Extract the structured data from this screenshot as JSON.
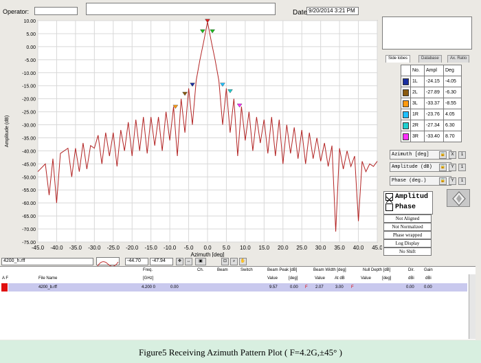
{
  "header": {
    "operator_label": "Operator:",
    "operator_value": "",
    "comment_value": "",
    "date_label": "Date",
    "date_value": "9/20/2014 3:21 PM"
  },
  "chart_data": {
    "type": "line",
    "title": "",
    "xlabel": "Azimuth  [deg]",
    "ylabel": "Amplitude  (dB)",
    "xlim": [
      -45,
      45
    ],
    "ylim": [
      -75,
      10
    ],
    "xticks": [
      "-45.0",
      "-40.0",
      "-35.0",
      "-30.0",
      "-25.0",
      "-20.0",
      "-15.0",
      "-10.0",
      "-5.0",
      "0.0",
      "5.0",
      "10.0",
      "15.0",
      "20.0",
      "25.0",
      "30.0",
      "35.0",
      "40.0",
      "45.0"
    ],
    "yticks": [
      "10.00",
      "5.00",
      "0.00",
      "-5.00",
      "-10.00",
      "-15.00",
      "-20.00",
      "-25.00",
      "-30.00",
      "-35.00",
      "-40.00",
      "-45.00",
      "-50.00",
      "-55.00",
      "-60.00",
      "-65.00",
      "-70.00",
      "-75.00"
    ],
    "grid": true,
    "series": [
      {
        "color": "#b22222",
        "points": [
          [
            -45,
            -48
          ],
          [
            -43,
            -45
          ],
          [
            -42,
            -57
          ],
          [
            -41,
            -43
          ],
          [
            -40,
            -60
          ],
          [
            -39,
            -41
          ],
          [
            -37,
            -39
          ],
          [
            -36,
            -50
          ],
          [
            -35,
            -39
          ],
          [
            -34,
            -48
          ],
          [
            -33,
            -37
          ],
          [
            -32,
            -47
          ],
          [
            -31,
            -38
          ],
          [
            -30,
            -39
          ],
          [
            -29,
            -34
          ],
          [
            -28,
            -45
          ],
          [
            -27,
            -33
          ],
          [
            -26,
            -42
          ],
          [
            -25,
            -33
          ],
          [
            -24,
            -46
          ],
          [
            -23,
            -32
          ],
          [
            -22,
            -40
          ],
          [
            -21,
            -29
          ],
          [
            -20,
            -42
          ],
          [
            -19,
            -28
          ],
          [
            -18,
            -40
          ],
          [
            -17,
            -27
          ],
          [
            -16,
            -41
          ],
          [
            -15,
            -27
          ],
          [
            -14,
            -38
          ],
          [
            -13,
            -27
          ],
          [
            -12,
            -40
          ],
          [
            -11,
            -25
          ],
          [
            -10,
            -36
          ],
          [
            -9,
            -23
          ],
          [
            -8,
            -42
          ],
          [
            -7,
            -20
          ],
          [
            -6,
            -33
          ],
          [
            -5,
            -16
          ],
          [
            -4,
            -30
          ],
          [
            -3,
            -13
          ],
          [
            -2,
            -5
          ],
          [
            -1,
            2
          ],
          [
            0,
            9.5
          ],
          [
            1,
            2
          ],
          [
            2,
            -5
          ],
          [
            3,
            -13
          ],
          [
            4,
            -30
          ],
          [
            5,
            -16
          ],
          [
            6,
            -33
          ],
          [
            7,
            -20
          ],
          [
            8,
            -42
          ],
          [
            9,
            -23
          ],
          [
            10,
            -36
          ],
          [
            11,
            -25
          ],
          [
            12,
            -40
          ],
          [
            13,
            -27
          ],
          [
            14,
            -37
          ],
          [
            15,
            -28
          ],
          [
            16,
            -41
          ],
          [
            17,
            -27
          ],
          [
            18,
            -42
          ],
          [
            19,
            -28
          ],
          [
            20,
            -45
          ],
          [
            21,
            -30
          ],
          [
            22,
            -41
          ],
          [
            23,
            -31
          ],
          [
            24,
            -43
          ],
          [
            25,
            -32
          ],
          [
            26,
            -45
          ],
          [
            27,
            -33
          ],
          [
            28,
            -43
          ],
          [
            29,
            -35
          ],
          [
            30,
            -44
          ],
          [
            31,
            -37
          ],
          [
            32,
            -46
          ],
          [
            33,
            -38
          ],
          [
            34,
            -71
          ],
          [
            35,
            -39
          ],
          [
            36,
            -47
          ],
          [
            37,
            -40
          ],
          [
            38,
            -46
          ],
          [
            39,
            -42
          ],
          [
            40,
            -67
          ],
          [
            41,
            -44
          ],
          [
            42,
            -48
          ],
          [
            43,
            -45
          ],
          [
            44,
            -46
          ],
          [
            45,
            -44
          ]
        ]
      }
    ],
    "markers": [
      {
        "x": 0,
        "y": 9.5,
        "color": "#e02020"
      },
      {
        "x": -1.3,
        "y": 5.5,
        "color": "#20c020"
      },
      {
        "x": 1.3,
        "y": 5.5,
        "color": "#20c020"
      },
      {
        "x": -4,
        "y": -15,
        "color": "#1a2fa0"
      },
      {
        "x": -6,
        "y": -18.5,
        "color": "#8a5a10"
      },
      {
        "x": -8.5,
        "y": -23.5,
        "color": "#ff9a10"
      },
      {
        "x": 4,
        "y": -15,
        "color": "#20c0ff"
      },
      {
        "x": 6,
        "y": -17.5,
        "color": "#20d0d0"
      },
      {
        "x": 8.5,
        "y": -23,
        "color": "#ff30ff"
      }
    ]
  },
  "side": {
    "tabs": [
      "Side lobes",
      "Database",
      "Ax. Ratio"
    ],
    "table_headers": [
      "No.",
      "Ampl",
      "Deg"
    ],
    "rows": [
      {
        "color": "#1a2fa0",
        "no": "1L",
        "ampl": "-24.15",
        "deg": "-4.05"
      },
      {
        "color": "#8a5a10",
        "no": "2L",
        "ampl": "-27.89",
        "deg": "-6.30"
      },
      {
        "color": "#ff9a10",
        "no": "3L",
        "ampl": "-33.37",
        "deg": "-8.55"
      },
      {
        "color": "#20c0ff",
        "no": "1R",
        "ampl": "-23.76",
        "deg": "4.05"
      },
      {
        "color": "#20d0d0",
        "no": "2R",
        "ampl": "-27.34",
        "deg": "6.30"
      },
      {
        "color": "#ff30ff",
        "no": "3R",
        "ampl": "-33.40",
        "deg": "8.70"
      }
    ],
    "controls": [
      "Azimuth  [deg]",
      "Amplitude (dB)",
      "Phase (deg.)"
    ],
    "check_amplitude": "Amplitud",
    "check_phase": "Phase",
    "options": [
      "Not Aligned",
      "Not Normalized",
      "Phase wrapped",
      "Log Display",
      "No Shift"
    ]
  },
  "bottom": {
    "file": "4200_h.rff",
    "field1": "-44.70",
    "field2": "-47.94"
  },
  "grid": {
    "h_af": "A F",
    "h_file": "File Name",
    "h_freq": "Freq.",
    "h_freq_u": "[GHz]",
    "h_ch": "Ch.",
    "h_beam": "Beam",
    "h_switch": "Switch",
    "h_peak": "Beam Peak [dB]",
    "h_value": "Value",
    "h_deg": "[deg]",
    "h_bw": "Beam Width [deg]",
    "h_value2": "Value",
    "h_atdb": "At dB",
    "h_null": "Null Depth [dB]",
    "h_value3": "Value",
    "h_deg2": "[deg]",
    "h_dir": "Dir.",
    "h_dbi": "dBi",
    "h_gain": "Gain",
    "h_dbi2": "dBi",
    "row": {
      "file": "4200_b.rff",
      "freq": "4.200 0",
      "ch": "0.00",
      "peak_v": "9.57",
      "peak_d": "0.00",
      "flag1": "F",
      "bw_v": "2.07",
      "bw_at": "3.00",
      "flag2": "F",
      "dir": "0.00",
      "gain": "0.00"
    }
  },
  "caption": "Figure5 Receiving Azimuth Pattern Plot ( F=4.2G,±45° )"
}
